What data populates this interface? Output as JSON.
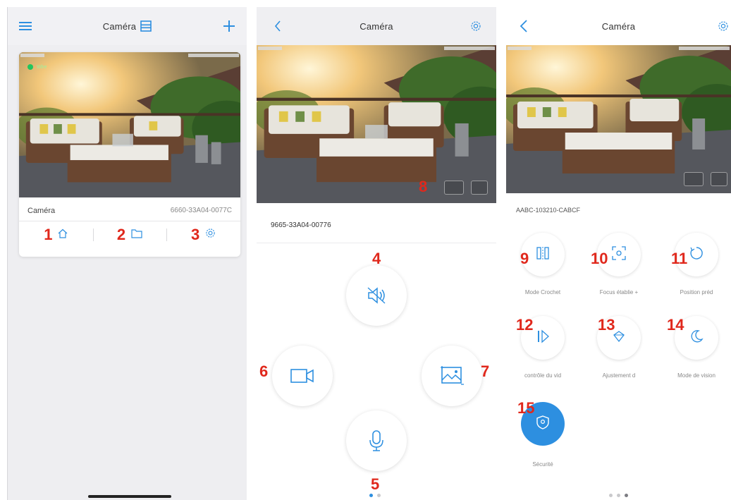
{
  "colors": {
    "accent": "#2d8fe0",
    "marker": "#e0281c",
    "online": "#22c55e"
  },
  "screen1": {
    "title": "Caméra",
    "icons": {
      "menu": "hamburger-icon",
      "list": "list-icon",
      "add": "plus-icon"
    },
    "card": {
      "name": "Caméra",
      "uid": "6660-33A04-0077C",
      "online_label": "Wlre",
      "actions": [
        {
          "marker": "1",
          "icon": "house-icon"
        },
        {
          "marker": "2",
          "icon": "folder-icon"
        },
        {
          "marker": "3",
          "icon": "gear-icon"
        }
      ]
    }
  },
  "screen2": {
    "title": "Caméra",
    "uid": "9665-33A04-00776",
    "markers": {
      "fullscreen": "8",
      "sound": "4",
      "talk": "5",
      "record": "6",
      "snapshot": "7"
    }
  },
  "screen3": {
    "title": "Caméra",
    "uid": "AABC-103210-CABCF",
    "functions": [
      {
        "marker": "9",
        "label": "Mode Crochet",
        "icon": "flip-icon"
      },
      {
        "marker": "10",
        "label": "Focus établie +",
        "icon": "focus-icon"
      },
      {
        "marker": "11",
        "label": "Position préd",
        "icon": "preset-icon"
      },
      {
        "marker": "12",
        "label": "contrôle du vid",
        "icon": "playback-icon"
      },
      {
        "marker": "13",
        "label": "Ajustement d",
        "icon": "adjust-icon"
      },
      {
        "marker": "14",
        "label": "Mode de vision",
        "icon": "night-vision-icon"
      },
      {
        "marker": "15",
        "label": "Sécurité",
        "icon": "shield-icon"
      }
    ]
  }
}
